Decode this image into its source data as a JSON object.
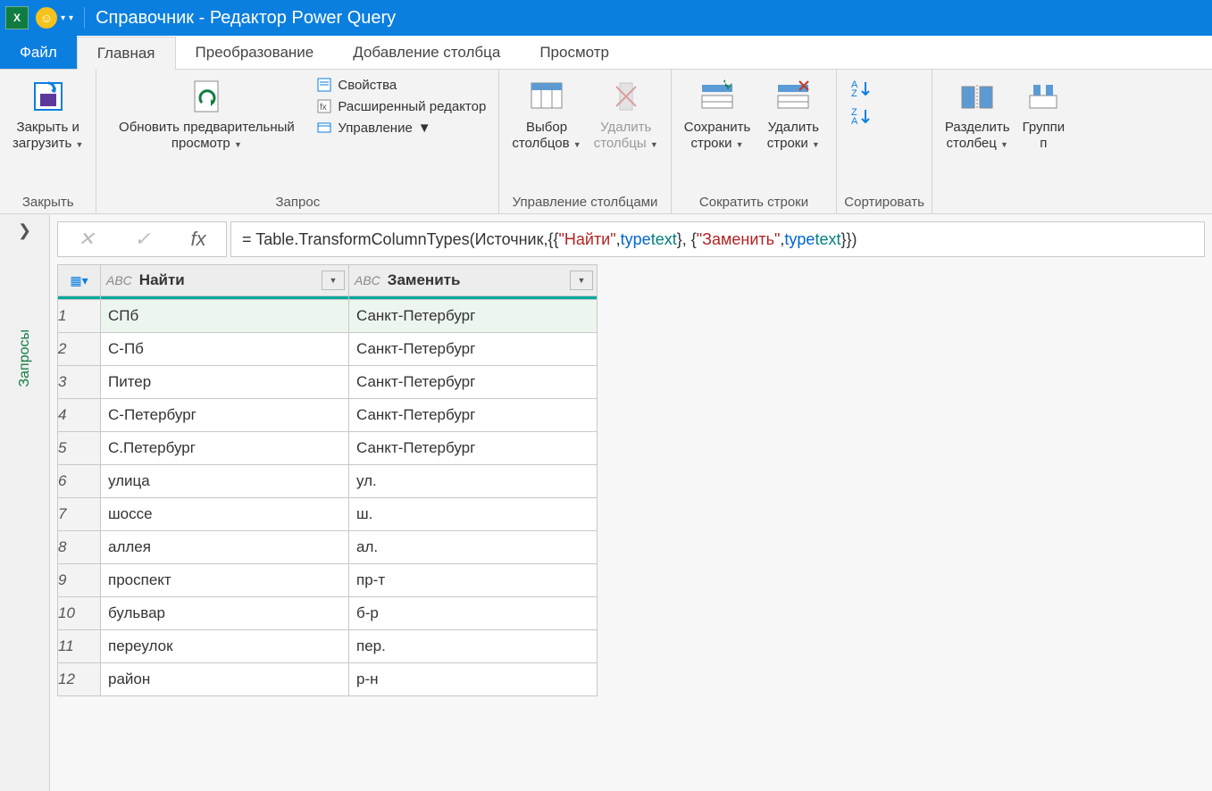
{
  "titlebar": {
    "title": "Справочник - Редактор Power Query"
  },
  "tabs": {
    "file": "Файл",
    "items": [
      "Главная",
      "Преобразование",
      "Добавление столбца",
      "Просмотр"
    ],
    "active": 0
  },
  "ribbon": {
    "close": {
      "label": "Закрыть",
      "btn": "Закрыть и\nзагрузить"
    },
    "query": {
      "label": "Запрос",
      "refresh": "Обновить предварительный\nпросмотр",
      "props": "Свойства",
      "adv": "Расширенный редактор",
      "manage": "Управление"
    },
    "cols": {
      "label": "Управление столбцами",
      "choose": "Выбор\nстолбцов",
      "remove": "Удалить\nстолбцы"
    },
    "rows": {
      "label": "Сократить строки",
      "keep": "Сохранить\nстроки",
      "remove": "Удалить\nстроки"
    },
    "sort": {
      "label": "Сортировать"
    },
    "split": {
      "label": "",
      "split": "Разделить\nстолбец",
      "group": "Группи\nп"
    }
  },
  "sidebar": {
    "label": "Запросы"
  },
  "formula": {
    "prefix": "= Table.TransformColumnTypes(Источник,{{",
    "s1": "\"Найти\"",
    "c1": ", ",
    "kw": "type",
    "sp": " ",
    "ty": "text",
    "mid": "}, {",
    "s2": "\"Заменить\"",
    "end": "}})"
  },
  "grid": {
    "type_label": "ABC",
    "columns": [
      "Найти",
      "Заменить"
    ],
    "rows": [
      [
        "СПб",
        "Санкт-Петербург"
      ],
      [
        "С-Пб",
        "Санкт-Петербург"
      ],
      [
        "Питер",
        "Санкт-Петербург"
      ],
      [
        "С-Петербург",
        "Санкт-Петербург"
      ],
      [
        "С.Петербург",
        "Санкт-Петербург"
      ],
      [
        "улица",
        "ул."
      ],
      [
        "шоссе",
        "ш."
      ],
      [
        "аллея",
        "ал."
      ],
      [
        "проспект",
        "пр-т"
      ],
      [
        "бульвар",
        "б-р"
      ],
      [
        "переулок",
        "пер."
      ],
      [
        "район",
        "р-н"
      ]
    ]
  }
}
